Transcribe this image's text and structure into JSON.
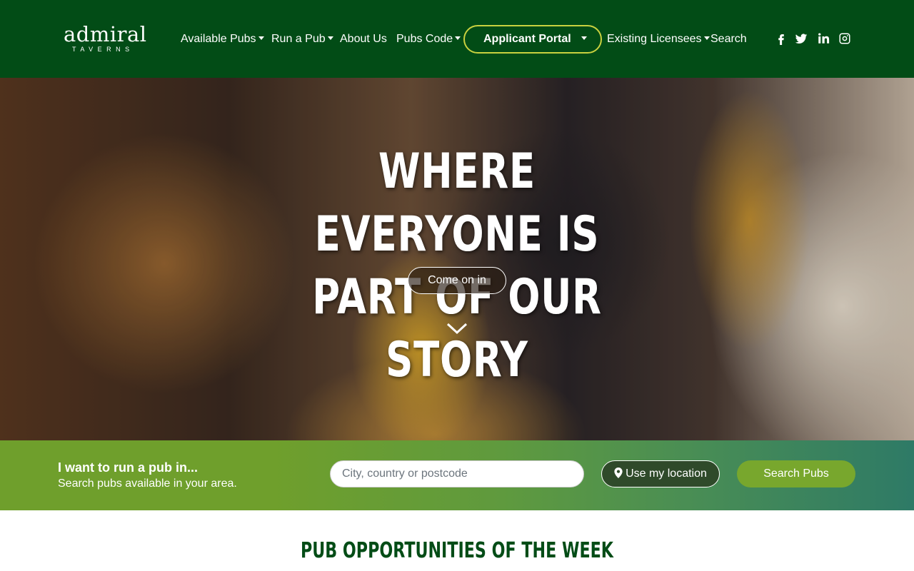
{
  "brand": {
    "logo_main": "admiral",
    "logo_sub": "TAVERNS"
  },
  "nav": {
    "available_pubs": "Available Pubs",
    "run_a_pub": "Run a Pub",
    "about_us": "About Us",
    "pubs_code": "Pubs Code",
    "applicant_portal": "Applicant Portal",
    "existing_licensees": "Existing Licensees",
    "search": "Search",
    "social": [
      "facebook-icon",
      "twitter-icon",
      "linkedin-icon",
      "instagram-icon"
    ]
  },
  "hero": {
    "line1": "Where everyone is",
    "line2": "part of our story",
    "cta": "Come on in"
  },
  "search_band": {
    "title": "I want to run a pub in...",
    "subtitle": "Search pubs available in your area.",
    "placeholder": "City, country or postcode",
    "location_button": "Use my location",
    "search_button": "Search Pubs"
  },
  "section": {
    "title": "Pub opportunities of the week"
  },
  "colors": {
    "nav_bg": "#024c16",
    "accent_outline": "#c9d13f",
    "band_green": "#6f9f2c",
    "search_button": "#78a72d"
  }
}
